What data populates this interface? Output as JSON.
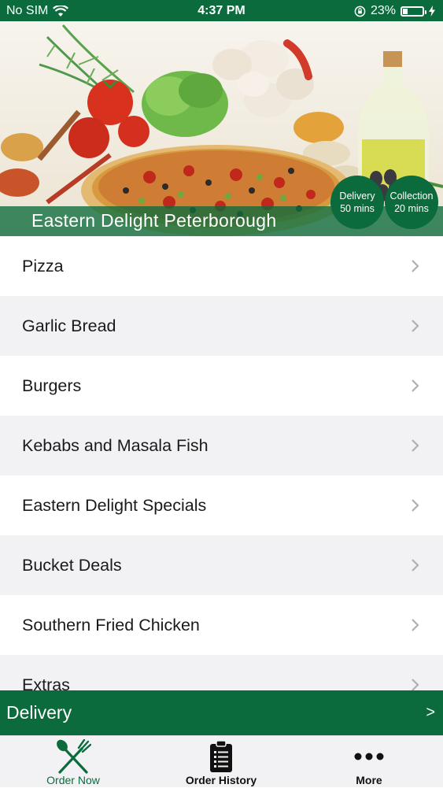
{
  "status_bar": {
    "carrier": "No SIM",
    "time": "4:37 PM",
    "battery": "23%",
    "battery_level": 0.23
  },
  "hero": {
    "restaurant_name": "Eastern Delight Peterborough",
    "delivery_badge": {
      "label": "Delivery",
      "time": "50 mins"
    },
    "collection_badge": {
      "label": "Collection",
      "time": "20 mins"
    }
  },
  "menu": {
    "categories": [
      "Pizza",
      "Garlic Bread",
      "Burgers",
      "Kebabs and Masala Fish",
      "Eastern Delight Specials",
      "Bucket Deals",
      "Southern Fried Chicken",
      "Extras"
    ]
  },
  "order_mode_bar": {
    "label": "Delivery",
    "arrow": ">"
  },
  "tab_bar": {
    "tabs": [
      {
        "label": "Order Now",
        "icon": "fork-knife-icon",
        "active": true
      },
      {
        "label": "Order History",
        "icon": "clipboard-list-icon",
        "active": false
      },
      {
        "label": "More",
        "icon": "more-dots-icon",
        "active": false
      }
    ]
  },
  "colors": {
    "brand_green": "#0c6b3c",
    "list_alt_bg": "#f2f2f4"
  }
}
